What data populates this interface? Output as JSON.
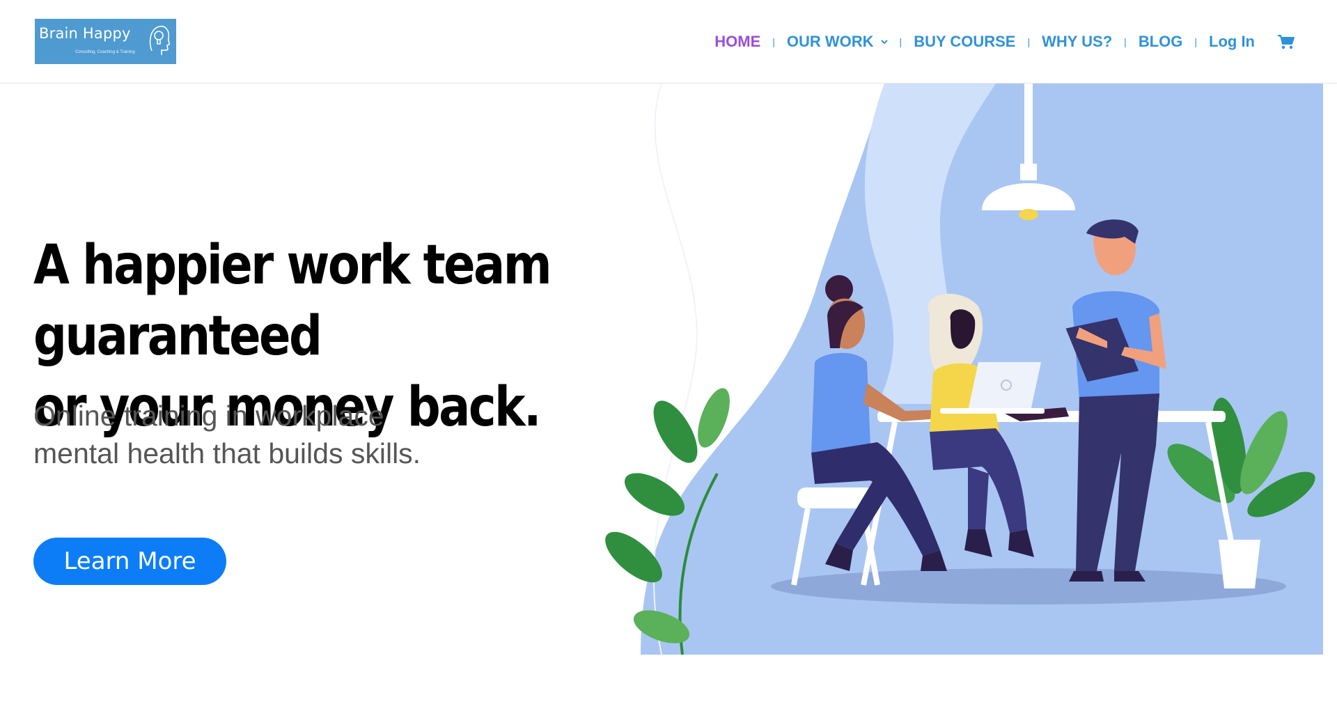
{
  "logo": {
    "name": "Brain Happy",
    "tagline": "Consulting, Coaching & Training"
  },
  "nav": {
    "items": [
      {
        "label": "HOME",
        "active": true
      },
      {
        "label": "OUR WORK",
        "dropdown": true
      },
      {
        "label": "BUY COURSE"
      },
      {
        "label": "WHY US?"
      },
      {
        "label": "BLOG"
      }
    ],
    "login": "Log In",
    "cart_icon": "shopping-cart-icon"
  },
  "hero": {
    "title_line1": "A happier work team guaranteed",
    "title_line2": "or your money back.",
    "subtitle_line1": "Online training in workplace",
    "subtitle_line2": "mental health that builds skills.",
    "cta_label": "Learn More"
  },
  "colors": {
    "nav_link": "#2f92d8",
    "nav_active": "#9b4ed8",
    "cta_bg": "#0c7df7",
    "logo_bg": "#4f9ad1",
    "illustration_bg": "#a9c6f3"
  }
}
